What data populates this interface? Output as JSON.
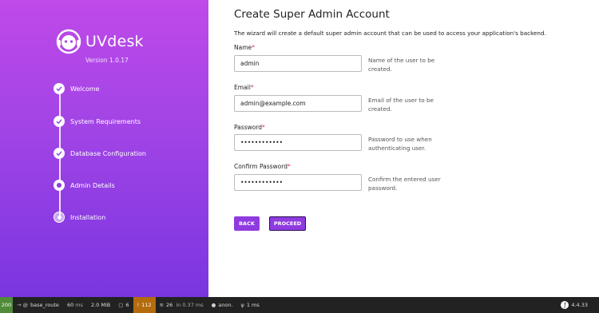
{
  "sidebar": {
    "brand": "UVdesk",
    "version": "Version 1.0.17",
    "steps": [
      {
        "label": "Welcome",
        "state": "done"
      },
      {
        "label": "System Requirements",
        "state": "done"
      },
      {
        "label": "Database Configuration",
        "state": "done"
      },
      {
        "label": "Admin Details",
        "state": "current"
      },
      {
        "label": "Installation",
        "state": "pending"
      }
    ]
  },
  "form": {
    "title": "Create Super Admin Account",
    "description": "The wizard will create a default super admin account that can be used to access your application's backend.",
    "fields": [
      {
        "label": "Name",
        "value": "admin",
        "help": "Name of the user to be created."
      },
      {
        "label": "Email",
        "value": "admin@example.com",
        "help": "Email of the user to be created."
      },
      {
        "label": "Password",
        "value": "••••••••••••",
        "help": "Password to use when authenticating user."
      },
      {
        "label": "Confirm Password",
        "value": "••••••••••••",
        "help": "Confirm the entered user password."
      }
    ],
    "required_mark": "*",
    "back_label": "BACK",
    "proceed_label": "PROCEED"
  },
  "toolbar": {
    "status_code": "200",
    "route": "base_route",
    "time_value": "60",
    "time_unit": "ms",
    "memory": "2.0 MiB",
    "forms_count": "6",
    "warnings": "112",
    "cache_hits": "26",
    "cache_time": "in 0.37 ms",
    "user": "anon.",
    "twig_time": "1 ms",
    "symfony_version": "4.4.33"
  },
  "colors": {
    "sidebar_top": "#c049e9",
    "sidebar_bottom": "#7a35e0",
    "button": "#8f3be0",
    "required": "#d9324b",
    "status_ok": "#4f8b38",
    "warning": "#b46b0e"
  }
}
